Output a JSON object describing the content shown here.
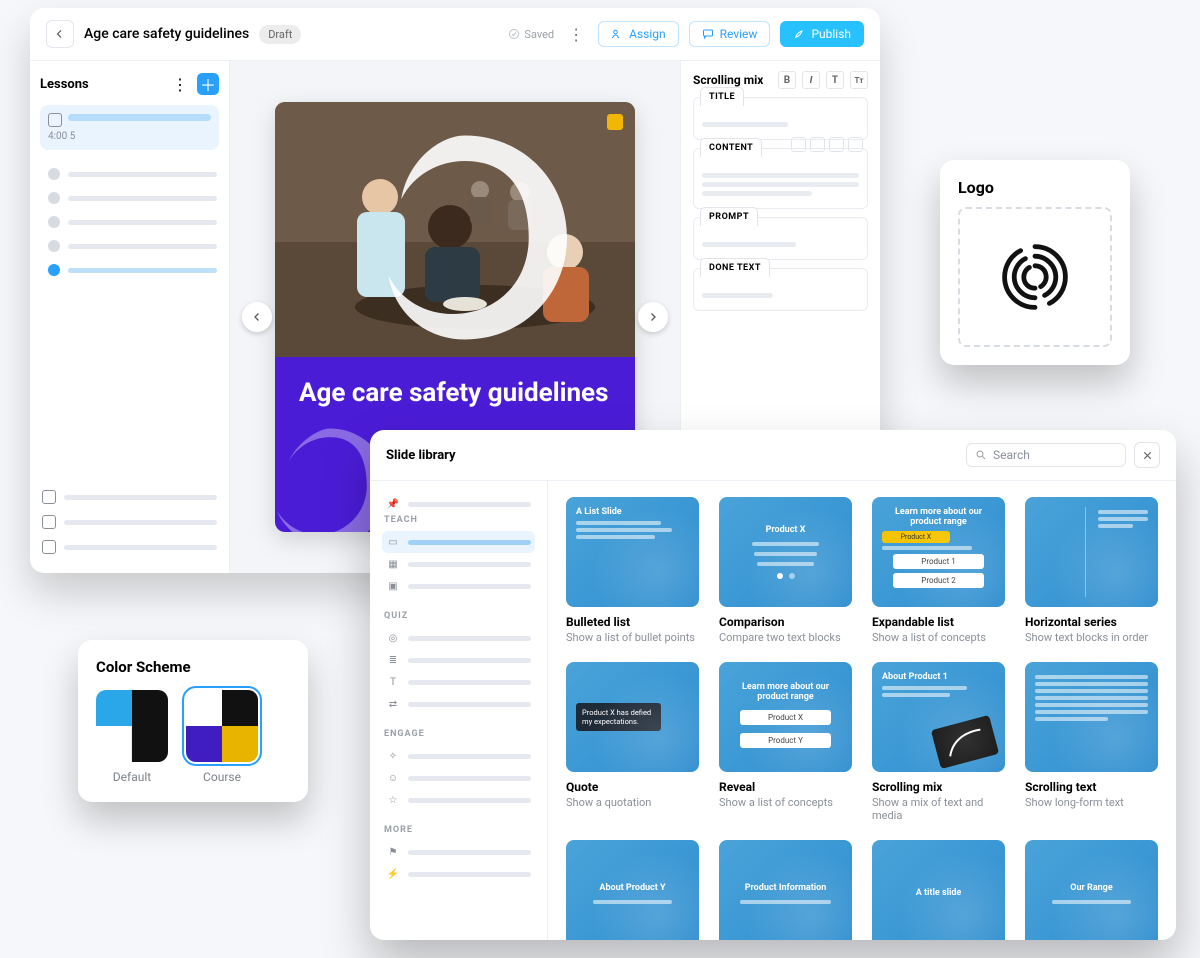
{
  "editor": {
    "title": "Age care safety guidelines",
    "status": "Draft",
    "saved_label": "Saved",
    "assign": "Assign",
    "review": "Review",
    "publish": "Publish",
    "lessons_heading": "Lessons",
    "selected_meta": "4:00    5",
    "slide_title": "Age care safety guidelines",
    "inspector_heading": "Scrolling mix",
    "panels": {
      "title": "TITLE",
      "content": "CONTENT",
      "prompt": "PROMPT",
      "done": "DONE TEXT"
    }
  },
  "logo": {
    "heading": "Logo"
  },
  "scheme": {
    "heading": "Color Scheme",
    "default_label": "Default",
    "course_label": "Course",
    "default_colors": [
      "#2aa7e8",
      "#111111",
      "#ffffff",
      "#111111"
    ],
    "course_colors": [
      "#ffffff",
      "#111111",
      "#3f1dc0",
      "#e9b400"
    ]
  },
  "library": {
    "heading": "Slide library",
    "search_placeholder": "Search",
    "groups": {
      "teach": "TEACH",
      "quiz": "QUIZ",
      "engage": "ENGAGE",
      "more": "MORE"
    },
    "templates": [
      {
        "name": "Bulleted list",
        "desc": "Show a list of bullet points"
      },
      {
        "name": "Comparison",
        "desc": "Compare two text blocks"
      },
      {
        "name": "Expandable list",
        "desc": "Show a list of concepts"
      },
      {
        "name": "Horizontal series",
        "desc": "Show text blocks in order"
      },
      {
        "name": "Quote",
        "desc": "Show a quotation"
      },
      {
        "name": "Reveal",
        "desc": "Show a list of concepts"
      },
      {
        "name": "Scrolling mix",
        "desc": "Show a mix of text and media"
      },
      {
        "name": "Scrolling text",
        "desc": "Show long-form text"
      }
    ],
    "thumb_text": {
      "list_title": "A List Slide",
      "product_x": "Product X",
      "learn_more": "Learn more about our product range",
      "product1": "Product 1",
      "product2": "Product 2",
      "producty": "Product Y",
      "quote": "Product X has defied my expectations.",
      "about_product1": "About Product 1",
      "product_info": "Product Information",
      "about_producty": "About Product Y",
      "a_title_slide": "A title slide",
      "our_range": "Our Range"
    }
  }
}
